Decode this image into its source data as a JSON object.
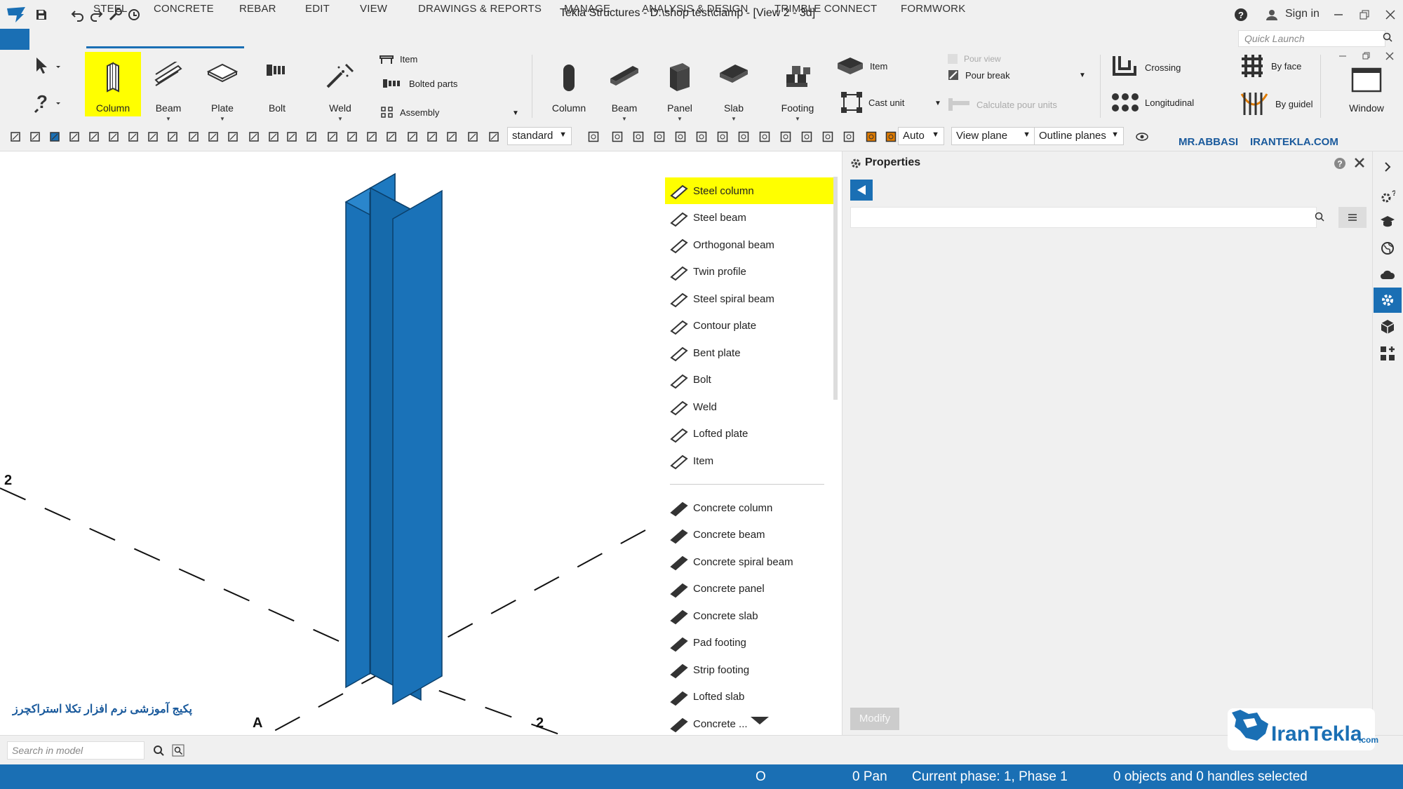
{
  "colors": {
    "accent": "#1a6fb4",
    "highlight": "#ffff00",
    "column": "#1a72b8"
  },
  "titlebar": {
    "title": "Tekla Structures - D:\\shop test\\clamp  - [View 2 - 3d]",
    "signin": "Sign in"
  },
  "tabs": [
    "STEEL",
    "CONCRETE",
    "REBAR",
    "EDIT",
    "VIEW",
    "DRAWINGS & REPORTS",
    "MANAGE",
    "ANALYSIS & DESIGN",
    "TRIMBLE CONNECT",
    "FORMWORK"
  ],
  "quick_launch": {
    "placeholder": "Quick Launch"
  },
  "ribbon": {
    "steel": {
      "column": "Column",
      "beam": "Beam",
      "plate": "Plate",
      "bolt": "Bolt",
      "weld": "Weld",
      "item": "Item",
      "bolted_parts": "Bolted parts",
      "assembly": "Assembly"
    },
    "concrete": {
      "column": "Column",
      "beam": "Beam",
      "panel": "Panel",
      "slab": "Slab",
      "footing": "Footing",
      "item": "Item",
      "cast_unit": "Cast unit",
      "pour_view": "Pour view",
      "pour_break": "Pour break",
      "calc_pour": "Calculate pour units"
    },
    "rebar": {
      "crossing": "Crossing",
      "longitudinal": "Longitudinal",
      "by_face": "By face",
      "by_guideline": "By guidel"
    },
    "window": "Window"
  },
  "toolbar": {
    "standard": "standard",
    "auto": "Auto",
    "view_plane": "View plane",
    "outline_planes": "Outline planes",
    "author": "MR.ABBASI",
    "site": "IRANTEKLA.COM"
  },
  "catalog": {
    "steel": [
      "Steel column",
      "Steel beam",
      "Orthogonal beam",
      "Twin profile",
      "Steel spiral beam",
      "Contour plate",
      "Bent plate",
      "Bolt",
      "Weld",
      "Lofted plate",
      "Item"
    ],
    "concrete": [
      "Concrete column",
      "Concrete beam",
      "Concrete spiral beam",
      "Concrete panel",
      "Concrete slab",
      "Pad footing",
      "Strip footing",
      "Lofted slab",
      "Concrete ..."
    ]
  },
  "properties": {
    "title": "Properties",
    "modify": "Modify"
  },
  "viewport": {
    "grid_2_left": "2",
    "grid_2_right": "2",
    "grid_a": "A",
    "persian_caption": "پکیج آموزشی نرم افزار تکلا استراکچرز"
  },
  "search_model": {
    "placeholder": "Search in model"
  },
  "status": {
    "o": "O",
    "pan": "0  Pan",
    "phase": "Current phase: 1, Phase 1",
    "selected": "0 objects and 0 handles selected"
  },
  "logo": {
    "text": "IranTekla",
    "com": ".com"
  }
}
